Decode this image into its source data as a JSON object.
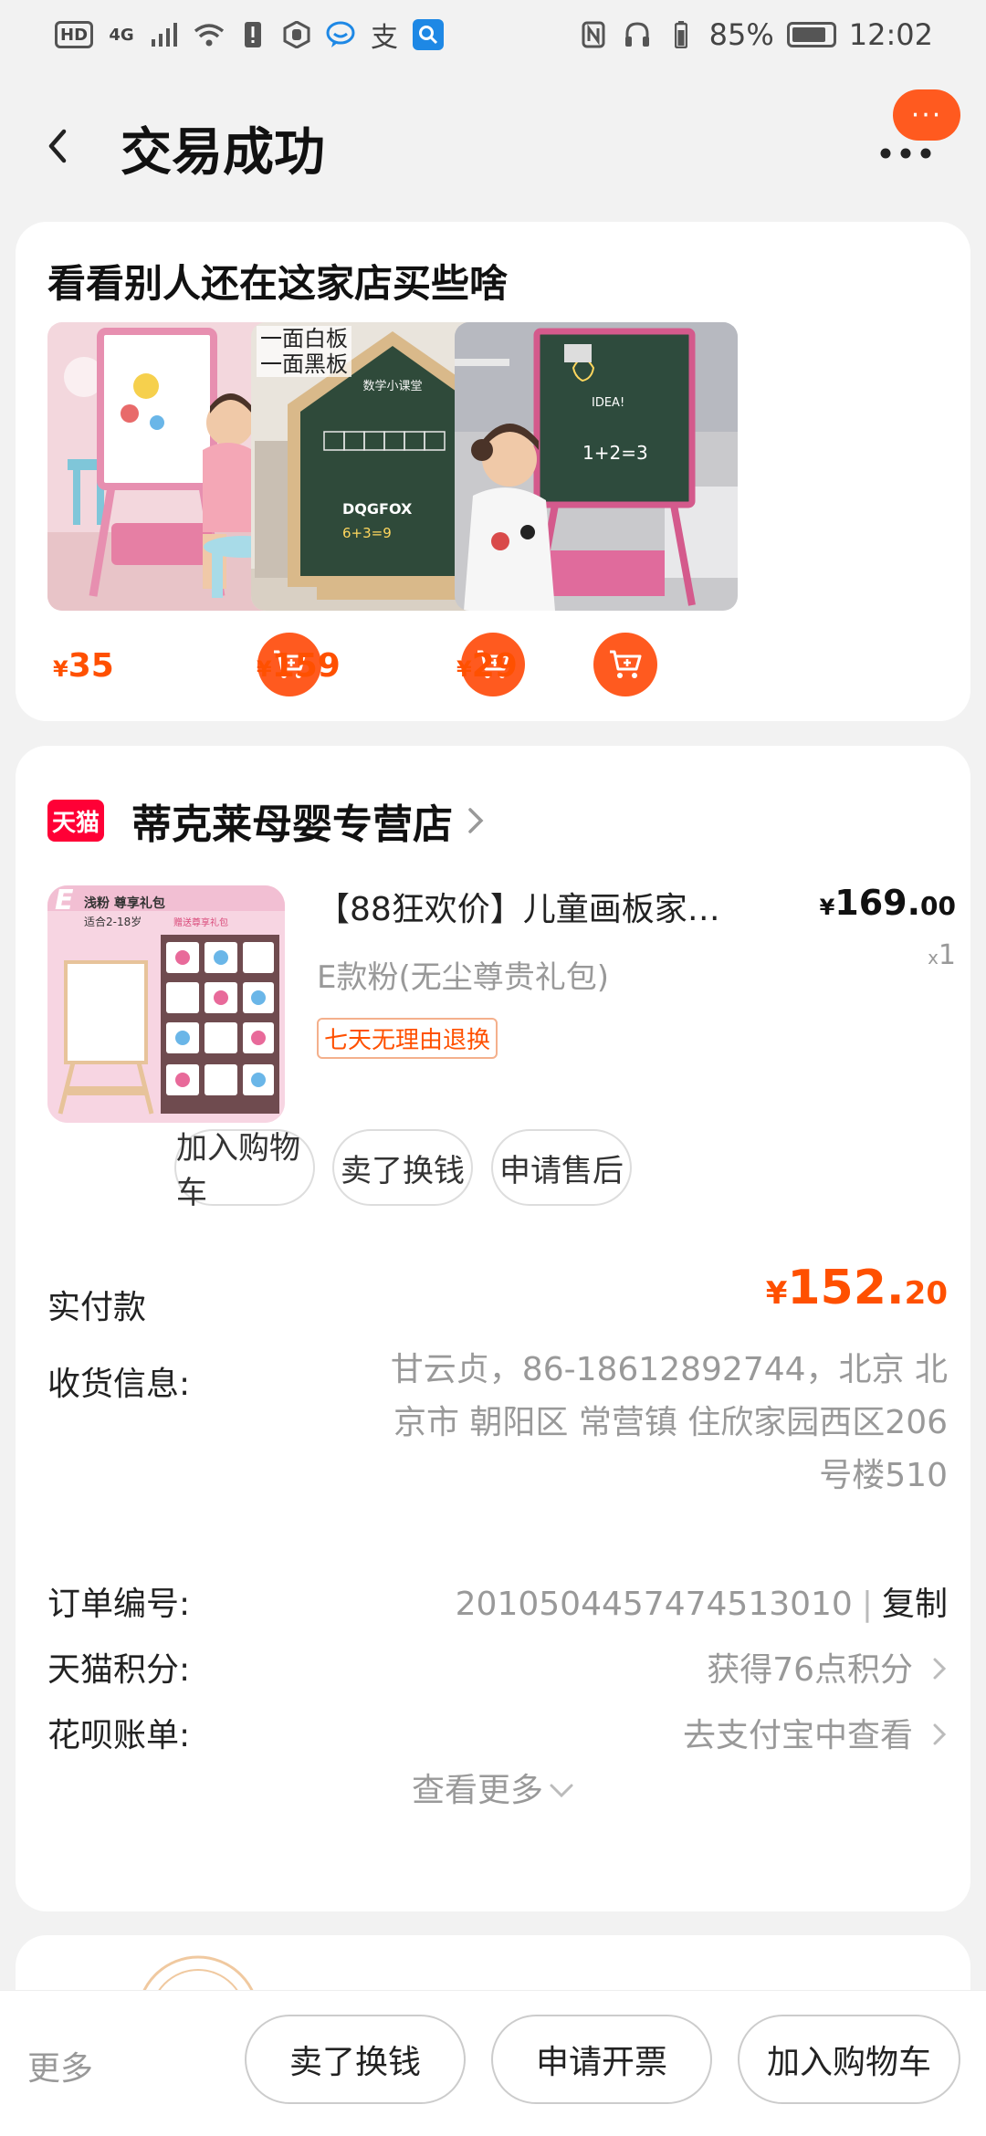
{
  "status_bar": {
    "left_icons": [
      "HD",
      "4G",
      "signal-icon",
      "wifi-icon",
      "alert-icon",
      "hand-icon",
      "chat-icon",
      "alipay-icon",
      "search-icon"
    ],
    "hd": "HD",
    "net": "4G",
    "battery_percent": "85%",
    "battery_level": 0.85,
    "time": "12:02"
  },
  "header": {
    "title": "交易成功",
    "message_badge": "···"
  },
  "recommend": {
    "title": "看看别人还在这家店买些啥",
    "items": [
      {
        "price": "35",
        "currency": "¥",
        "tag": ""
      },
      {
        "price": "159",
        "currency": "¥",
        "tag_line1": "一面白板",
        "tag_line2": "一面黑板"
      },
      {
        "price": "29",
        "currency": "¥",
        "tag": ""
      }
    ],
    "board_texts": {
      "item2_heading": "数学小课堂",
      "item2_letters": "DQGFOX",
      "item2_math": "6+3=9",
      "item3_idea": "IDEA!",
      "item3_math": "1+2=3"
    }
  },
  "order": {
    "shop_logo": "天猫",
    "shop_name": "蒂克莱母婴专营店",
    "product": {
      "image_title": "浅粉 尊享礼包",
      "image_subtitle": "适合2-18岁",
      "image_note": "赠送尊享礼包",
      "name": "【88狂欢价】儿童画板家…",
      "spec": "E款粉(无尘尊贵礼包)",
      "badge": "七天无理由退换",
      "price_currency": "¥",
      "price_int": "169.",
      "price_cents": "00",
      "qty_x": "x",
      "qty": "1"
    },
    "actions": [
      "加入购物车",
      "卖了换钱",
      "申请售后"
    ],
    "payment": {
      "label": "实付款",
      "currency": "¥",
      "amount_int": "152.",
      "amount_cents": "20"
    },
    "shipping": {
      "label": "收货信息:",
      "line1": "甘云贞，86-18612892744，北京 北",
      "line2": "京市 朝阳区 常营镇 住欣家园西区206",
      "line3": "号楼510"
    },
    "order_no": {
      "label": "订单编号:",
      "value": "2010504457474513010",
      "separator": "|",
      "copy": "复制"
    },
    "points": {
      "label": "天猫积分:",
      "value": "获得76点积分"
    },
    "huabei": {
      "label": "花呗账单:",
      "value": "去支付宝中查看"
    },
    "see_more": "查看更多"
  },
  "bottom_bar": {
    "more": "更多",
    "buttons": [
      "卖了换钱",
      "申请开票",
      "加入购物车"
    ]
  },
  "colors": {
    "accent": "#ff5000",
    "tmall_red": "#ff0036",
    "background": "#f2f2f2"
  }
}
